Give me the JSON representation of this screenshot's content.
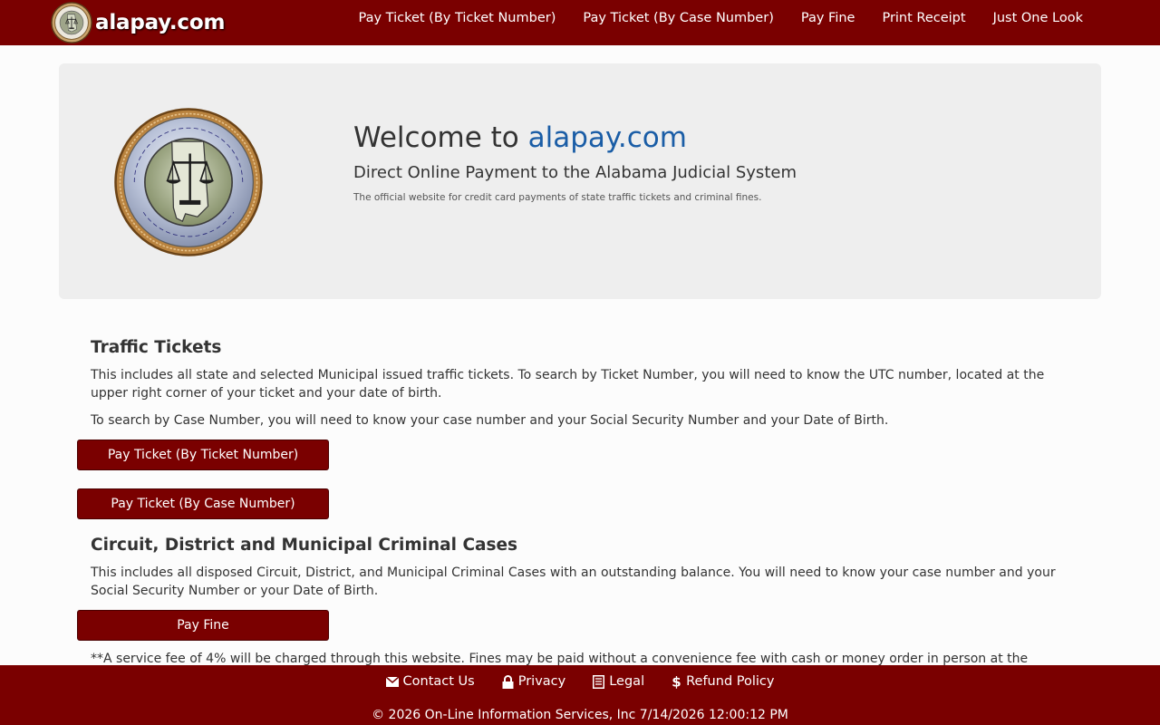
{
  "navbar": {
    "brand": "alapay.com",
    "links": [
      "Pay Ticket (By Ticket Number)",
      "Pay Ticket (By Case Number)",
      "Pay Fine",
      "Print Receipt",
      "Just One Look"
    ]
  },
  "hero": {
    "welcome_prefix": "Welcome to ",
    "welcome_site": "alapay.com",
    "subtitle": "Direct Online Payment to the Alabama Judicial System",
    "description": "The official website for credit card payments of state traffic tickets and criminal fines."
  },
  "traffic": {
    "title": "Traffic Tickets",
    "para1": "This includes all state and selected Municipal issued traffic tickets.  To search by Ticket Number, you will need to know the UTC number, located at the upper right corner of your ticket and your date of birth.",
    "para2": "To search by Case Number, you will need to know your case number and your Social Security Number and your Date of Birth.",
    "btn_ticket": "Pay Ticket (By Ticket Number)",
    "btn_case": "Pay Ticket (By Case Number)"
  },
  "criminal": {
    "title": "Circuit, District and Municipal Criminal Cases",
    "para": "This includes all disposed Circuit, District, and Municipal Criminal Cases with an outstanding balance.  You will need to know your case number and your Social Security Number or your Date of Birth.",
    "btn_fine": "Pay Fine"
  },
  "fee_note": "**A service fee of 4% will be charged through this website.  Fines may be paid without a convenience fee with cash or money order in person at the",
  "footer": {
    "contact": "Contact Us",
    "privacy": "Privacy",
    "legal": "Legal",
    "refund": "Refund Policy",
    "copyright": "© 2026 On-Line Information Services, Inc 7/14/2026 12:00:12 PM"
  },
  "colors": {
    "brand_red": "#7a0000",
    "link_blue": "#1a5da6",
    "hero_bg": "#eeeeee"
  },
  "icons": [
    "seal-logo",
    "envelope-icon",
    "lock-icon",
    "document-icon",
    "dollar-icon"
  ]
}
